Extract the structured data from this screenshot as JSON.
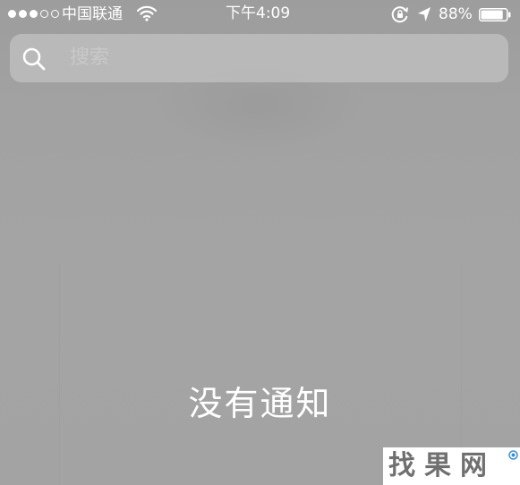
{
  "status_bar": {
    "carrier": "中国联通",
    "time": "下午4:09",
    "battery_percent": "88%",
    "battery_level": 0.88,
    "signal_strength": 3,
    "signal_max": 5,
    "icons": [
      "signal-dots-icon",
      "wifi-icon",
      "rotation-lock-icon",
      "location-arrow-icon",
      "battery-icon"
    ]
  },
  "search": {
    "placeholder": "搜索",
    "icon": "search-icon"
  },
  "notifications": {
    "empty_text": "没有通知"
  },
  "watermark": {
    "text": "找果网"
  },
  "colors": {
    "background": "#a3a3a3",
    "text": "#ffffff",
    "search_bg": "#c8c8c8",
    "placeholder": "#c9c9c9"
  }
}
